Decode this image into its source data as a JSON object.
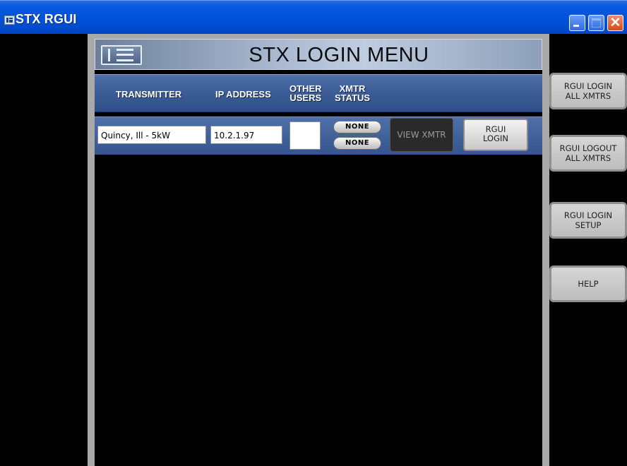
{
  "window": {
    "title": "STX RGUI"
  },
  "header": {
    "title": "STX LOGIN MENU"
  },
  "columns": {
    "transmitter": "TRANSMITTER",
    "ip_address": "IP ADDRESS",
    "other_users_line1": "OTHER",
    "other_users_line2": "USERS",
    "xmtr_status_line1": "XMTR",
    "xmtr_status_line2": "STATUS"
  },
  "rows": [
    {
      "transmitter": "Quincy, Ill - 5kW",
      "ip_address": "10.2.1.97",
      "other_users": "",
      "status_top": "NONE",
      "status_bottom": "NONE",
      "view_label": "VIEW XMTR",
      "login_line1": "RGUI",
      "login_line2": "LOGIN"
    }
  ],
  "side_buttons": [
    {
      "line1": "RGUI LOGIN",
      "line2": "ALL XMTRS"
    },
    {
      "line1": "RGUI LOGOUT",
      "line2": "ALL XMTRS"
    },
    {
      "line1": "RGUI LOGIN",
      "line2": "SETUP"
    },
    {
      "line1": "HELP",
      "line2": ""
    }
  ],
  "colors": {
    "titlebar": "#0050d8",
    "header_bar": "#3c5c96",
    "background": "#000000"
  }
}
